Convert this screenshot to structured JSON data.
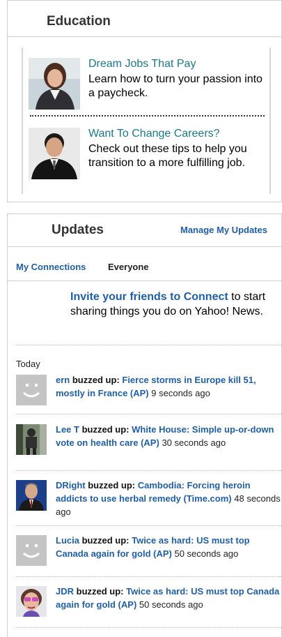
{
  "education": {
    "title": "Education",
    "items": [
      {
        "link": "Dream Jobs That Pay",
        "desc": "Learn how to turn your passion into a paycheck.",
        "thumb": "woman-portrait-photo"
      },
      {
        "link": "Want To Change Careers?",
        "desc": "Check out these tips to help you transition to a more fulfilling job.",
        "thumb": "man-portrait-photo"
      }
    ]
  },
  "updates": {
    "title": "Updates",
    "manage_label": "Manage My Updates",
    "tabs": [
      "My Connections",
      "Everyone"
    ],
    "invite_link": "Invite your friends to Connect",
    "invite_rest": " to start sharing things you do on Yahoo! News.",
    "today_label": "Today",
    "feed": [
      {
        "user": "ern",
        "verb": "buzzed up:",
        "story": "Fierce storms in Europe kill 51, mostly in France (AP)",
        "time": "9 seconds ago",
        "avatar": "default-smiley-avatar"
      },
      {
        "user": "Lee T",
        "verb": "buzzed up:",
        "story": "White House: Simple up-or-down vote on health care (AP)",
        "time": "30 seconds ago",
        "avatar": "figure-photo-avatar"
      },
      {
        "user": "DRight",
        "verb": "buzzed up:",
        "story": "Cambodia: Forcing heroin addicts to use herbal remedy (Time.com)",
        "time": "48 seconds ago",
        "avatar": "man-in-suit-avatar"
      },
      {
        "user": "Lucia",
        "verb": "buzzed up:",
        "story": "Twice as hard: US must top Canada again for gold (AP)",
        "time": "50 seconds ago",
        "avatar": "default-smiley-avatar"
      },
      {
        "user": "JDR",
        "verb": "buzzed up:",
        "story": "Twice as hard: US must top Canada again for gold (AP)",
        "time": "50 seconds ago",
        "avatar": "cartoon-face-avatar"
      }
    ]
  }
}
